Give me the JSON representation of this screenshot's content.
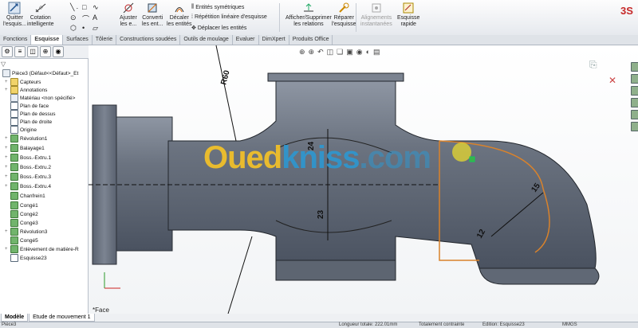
{
  "ribbon": {
    "buttons": [
      {
        "name": "quit-sketch-button",
        "label1": "Quitter",
        "label2": "l'esquis..."
      },
      {
        "name": "smart-dimension-button",
        "label1": "Cotation",
        "label2": "intelligente"
      },
      {
        "name": "trim-entities-button",
        "label1": "Ajuster",
        "label2": "les e..."
      },
      {
        "name": "convert-entities-button",
        "label1": "Converti",
        "label2": "les ent..."
      },
      {
        "name": "offset-entities-button",
        "label1": "Décaler",
        "label2": "les entités"
      },
      {
        "name": "display-relations-button",
        "label1": "Afficher/Supprimer",
        "label2": "les relations"
      },
      {
        "name": "repair-sketch-button",
        "label1": "Réparer",
        "label2": "l'esquisse"
      },
      {
        "name": "quick-snaps-button",
        "label1": "Alignements",
        "label2": "instantanées"
      },
      {
        "name": "rapid-sketch-button",
        "label1": "Esquisse",
        "label2": "rapide"
      }
    ],
    "small_items": {
      "mirror": "Entités symétriques",
      "linear_pattern": "Répétition linéaire d'esquisse",
      "move_entities": "Déplacer les entités"
    }
  },
  "tabs": [
    "Fonctions",
    "Esquisse",
    "Surfaces",
    "Tôlerie",
    "Constructions soudées",
    "Outils de moulage",
    "Evaluer",
    "DimXpert",
    "Produits Office"
  ],
  "active_tab": "Esquisse",
  "tree": {
    "root": "Pièce3  (Défaut<<Défaut>_Et",
    "items": [
      "Capteurs",
      "Annotations",
      "Matériau <non spécifié>",
      "Plan de face",
      "Plan de dessus",
      "Plan de droite",
      "Origine",
      "Révolution1",
      "Balayage1",
      "Boss.-Extru.1",
      "Boss.-Extru.2",
      "Boss.-Extru.3",
      "Boss.-Extru.4",
      "Chanfrein1",
      "Congé1",
      "Congé2",
      "Congé3",
      "Révolution3",
      "Congé5",
      "Enlèvement de matière-R",
      "Esquisse23"
    ]
  },
  "dimensions": {
    "r60": "R60",
    "d24": "24",
    "d23": "23",
    "d15": "15",
    "d12": "12"
  },
  "viewport_label": "*Face",
  "watermark": {
    "part1": "Oued",
    "part2": "kniss",
    "part3": ".com"
  },
  "bottom_tabs": [
    "Modèle",
    "Etude de mouvement 1"
  ],
  "status": {
    "left": "Pièce3",
    "length": "Longueur totale: 222.01mm",
    "constraint": "Totalement contrainte",
    "editing": "Edition: Esquisse23",
    "units": "MMGS"
  }
}
